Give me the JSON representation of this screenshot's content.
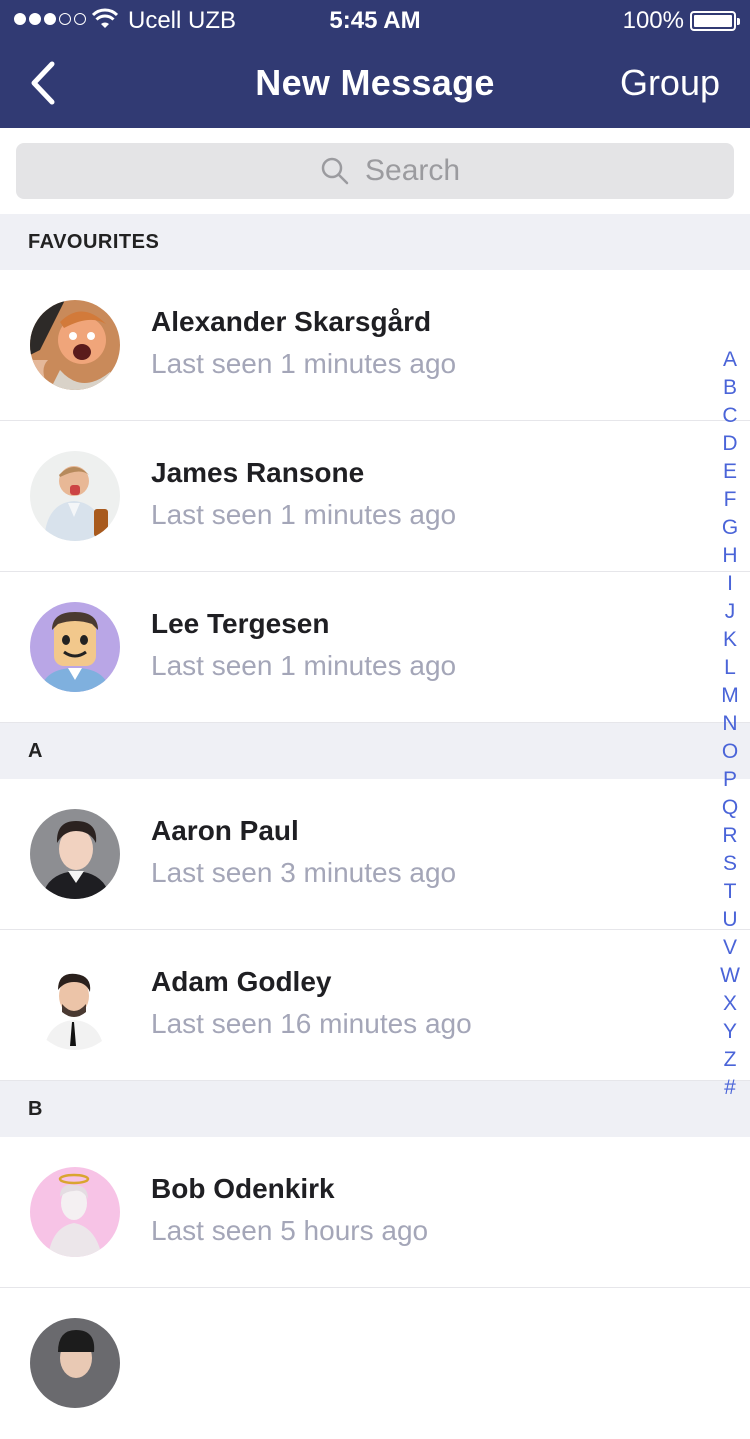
{
  "status_bar": {
    "carrier": "Ucell UZB",
    "time": "5:45 AM",
    "battery": "100%"
  },
  "nav": {
    "title": "New Message",
    "right_action": "Group"
  },
  "search": {
    "placeholder": "Search"
  },
  "sections": [
    {
      "header": "FAVOURITES",
      "contacts": [
        {
          "name": "Alexander Skarsgård",
          "status": "Last seen 1 minutes ago"
        },
        {
          "name": "James Ransone",
          "status": "Last seen 1 minutes ago"
        },
        {
          "name": "Lee Tergesen",
          "status": "Last seen 1 minutes ago"
        }
      ]
    },
    {
      "header": "A",
      "contacts": [
        {
          "name": "Aaron Paul",
          "status": "Last seen 3 minutes ago"
        },
        {
          "name": "Adam Godley",
          "status": "Last seen 16 minutes ago"
        }
      ]
    },
    {
      "header": "B",
      "contacts": [
        {
          "name": "Bob Odenkirk",
          "status": "Last seen 5 hours ago"
        }
      ]
    }
  ],
  "index_letters": [
    "A",
    "B",
    "C",
    "D",
    "E",
    "F",
    "G",
    "H",
    "I",
    "J",
    "K",
    "L",
    "M",
    "N",
    "O",
    "P",
    "Q",
    "R",
    "S",
    "T",
    "U",
    "V",
    "W",
    "X",
    "Y",
    "Z",
    "#"
  ],
  "colors": {
    "nav_bar": "#313a73",
    "section_bg": "#eff0f5",
    "index_accent": "#4a64d8",
    "subtitle": "#a4a6b8"
  }
}
